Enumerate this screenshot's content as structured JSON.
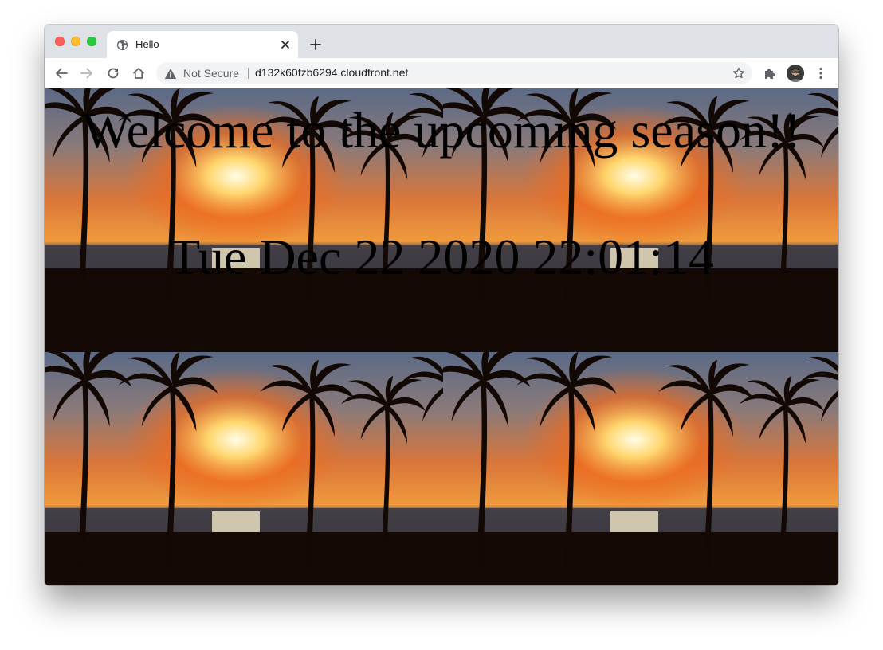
{
  "browser": {
    "tab": {
      "title": "Hello",
      "favicon": "globe-icon"
    },
    "toolbar": {
      "security_label": "Not Secure",
      "url": "d132k60fzb6294.cloudfront.net"
    }
  },
  "page": {
    "heading": "Welcome to the upcoming season!!",
    "datetime": "Tue Dec 22 2020 22:01:14",
    "background": "tropical-sunset-palm-trees-image"
  },
  "colors": {
    "tabstrip": "#dee1e6",
    "omnibox": "#f1f3f4",
    "close_light": "#fe5f57",
    "minimize_light": "#febc2e",
    "maximize_light": "#28c840"
  }
}
